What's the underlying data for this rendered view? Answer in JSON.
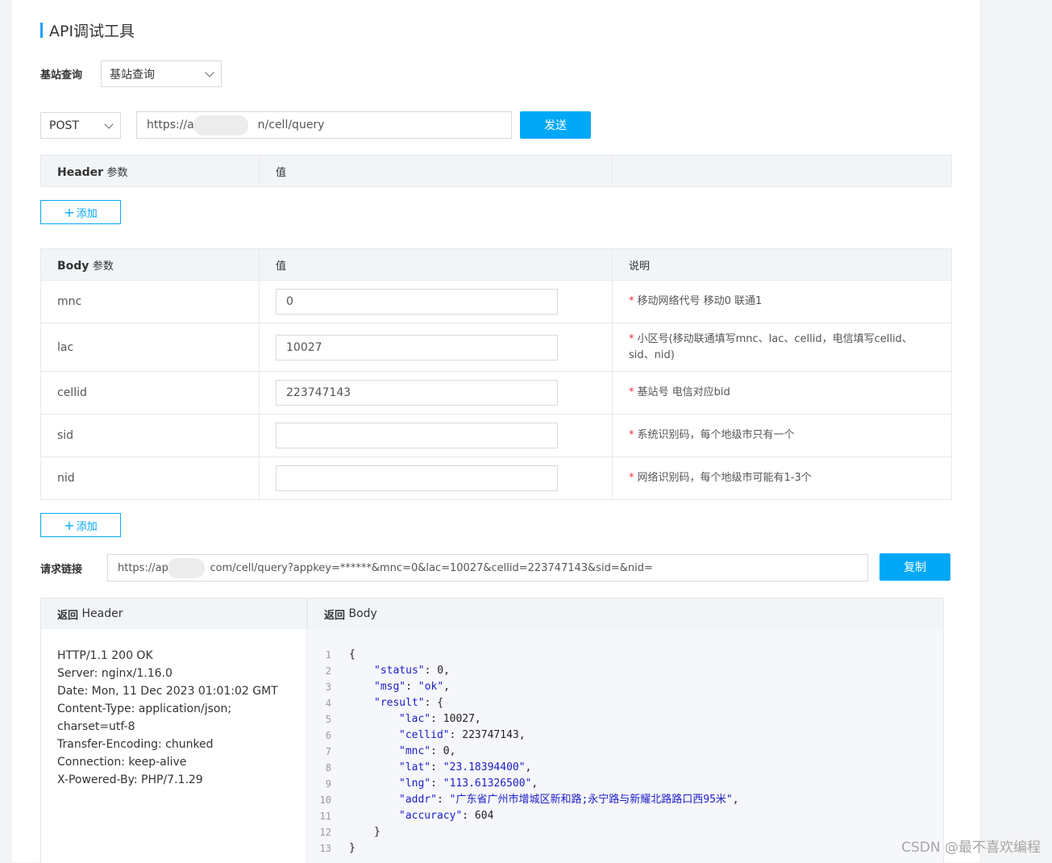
{
  "title": "API调试工具",
  "query_type": {
    "label": "基站查询",
    "selected": "基站查询"
  },
  "request": {
    "method": "POST",
    "url": "https://ap",
    "url_suffix": "n/cell/query",
    "send_label": "发送"
  },
  "header_table": {
    "col1": "Header",
    "col1_suffix": "参数",
    "col2": "值",
    "add_label": "添加"
  },
  "body_table": {
    "col1": "Body",
    "col1_suffix": "参数",
    "col2": "值",
    "col3": "说明",
    "add_label": "添加",
    "rows": [
      {
        "name": "mnc",
        "value": "0",
        "note": "移动网络代号 移动0 联通1"
      },
      {
        "name": "lac",
        "value": "10027",
        "note": "小区号(移动联通填写mnc、lac、cellid，电信填写cellid、sid、nid)"
      },
      {
        "name": "cellid",
        "value": "223747143",
        "note": "基站号 电信对应bid"
      },
      {
        "name": "sid",
        "value": "",
        "note": "系统识别码，每个地级市只有一个"
      },
      {
        "name": "nid",
        "value": "",
        "note": "网络识别码，每个地级市可能有1-3个"
      }
    ]
  },
  "request_link": {
    "label": "请求链接",
    "prefix": "https://api",
    "rest": "com/cell/query?appkey=******&mnc=0&lac=10027&cellid=223747143&sid=&nid=",
    "copy_label": "复制"
  },
  "response": {
    "header_title_strong": "返回",
    "header_title": "Header",
    "body_title_strong": "返回",
    "body_title": "Body",
    "header_lines": [
      "HTTP/1.1 200 OK",
      "Server: nginx/1.16.0",
      "Date: Mon, 11 Dec 2023 01:01:02 GMT",
      "Content-Type: application/json;",
      "charset=utf-8",
      "Transfer-Encoding: chunked",
      "Connection: keep-alive",
      "X-Powered-By: PHP/7.1.29"
    ],
    "body_lines": [
      {
        "n": "1",
        "indent": 0,
        "parts": [
          [
            "p",
            "{"
          ]
        ]
      },
      {
        "n": "2",
        "indent": 1,
        "parts": [
          [
            "k",
            "\"status\""
          ],
          [
            "p",
            ": 0,"
          ]
        ]
      },
      {
        "n": "3",
        "indent": 1,
        "parts": [
          [
            "k",
            "\"msg\""
          ],
          [
            "p",
            ": "
          ],
          [
            "s",
            "\"ok\""
          ],
          [
            "p",
            ","
          ]
        ]
      },
      {
        "n": "4",
        "indent": 1,
        "parts": [
          [
            "k",
            "\"result\""
          ],
          [
            "p",
            ": {"
          ]
        ]
      },
      {
        "n": "5",
        "indent": 2,
        "parts": [
          [
            "k",
            "\"lac\""
          ],
          [
            "p",
            ": 10027,"
          ]
        ]
      },
      {
        "n": "6",
        "indent": 2,
        "parts": [
          [
            "k",
            "\"cellid\""
          ],
          [
            "p",
            ": 223747143,"
          ]
        ]
      },
      {
        "n": "7",
        "indent": 2,
        "parts": [
          [
            "k",
            "\"mnc\""
          ],
          [
            "p",
            ": 0,"
          ]
        ]
      },
      {
        "n": "8",
        "indent": 2,
        "parts": [
          [
            "k",
            "\"lat\""
          ],
          [
            "p",
            ": "
          ],
          [
            "s",
            "\"23.18394400\""
          ],
          [
            "p",
            ","
          ]
        ]
      },
      {
        "n": "9",
        "indent": 2,
        "parts": [
          [
            "k",
            "\"lng\""
          ],
          [
            "p",
            ": "
          ],
          [
            "s",
            "\"113.61326500\""
          ],
          [
            "p",
            ","
          ]
        ]
      },
      {
        "n": "10",
        "indent": 2,
        "parts": [
          [
            "k",
            "\"addr\""
          ],
          [
            "p",
            ": "
          ],
          [
            "s",
            "\"广东省广州市增城区新和路;永宁路与新耀北路路口西95米\""
          ],
          [
            "p",
            ","
          ]
        ]
      },
      {
        "n": "11",
        "indent": 2,
        "parts": [
          [
            "k",
            "\"accuracy\""
          ],
          [
            "p",
            ": 604"
          ]
        ]
      },
      {
        "n": "12",
        "indent": 1,
        "parts": [
          [
            "p",
            "}"
          ]
        ]
      },
      {
        "n": "13",
        "indent": 0,
        "parts": [
          [
            "p",
            "}"
          ]
        ]
      }
    ]
  },
  "watermark": "CSDN @最不喜欢编程"
}
